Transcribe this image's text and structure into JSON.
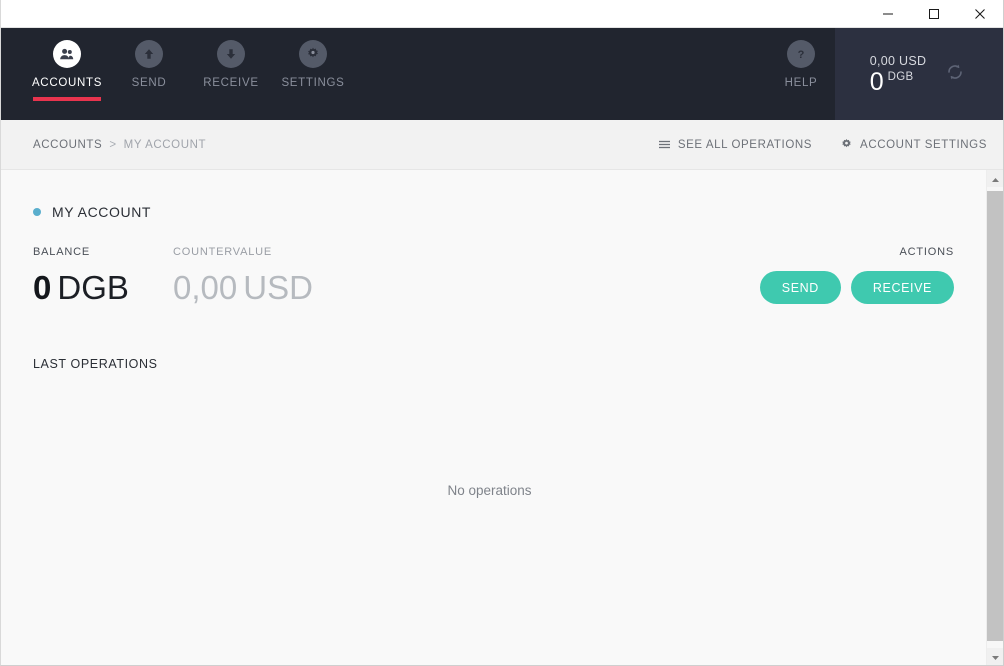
{
  "window": {
    "controls": [
      {
        "name": "minimize",
        "glyph": "minimize-icon",
        "label": "Minimize"
      },
      {
        "name": "maximize",
        "glyph": "maximize-icon",
        "label": "Maximize"
      },
      {
        "name": "close",
        "glyph": "close-icon",
        "label": "Close"
      }
    ]
  },
  "topnav": {
    "items": [
      {
        "label": "ACCOUNTS",
        "icon": "accounts-icon",
        "active": true
      },
      {
        "label": "SEND",
        "icon": "send-arrow-up-icon",
        "active": false
      },
      {
        "label": "RECEIVE",
        "icon": "receive-arrow-down-icon",
        "active": false
      },
      {
        "label": "SETTINGS",
        "icon": "gear-icon",
        "active": false
      }
    ],
    "help": {
      "label": "HELP",
      "icon": "question-mark-icon"
    },
    "active_indicator_color": "#e8344e",
    "background_color": "#21252f"
  },
  "balance_panel": {
    "fiat_value": "0,00 USD",
    "crypto_amount": "0",
    "crypto_unit": "DGB",
    "sync_icon": "refresh-sync-icon",
    "background_color": "#2c3040"
  },
  "breadcrumb": {
    "root": "ACCOUNTS",
    "separator": ">",
    "current": "MY ACCOUNT",
    "actions": [
      {
        "label": "SEE ALL OPERATIONS",
        "icon": "list-lines-icon"
      },
      {
        "label": "ACCOUNT SETTINGS",
        "icon": "gear-icon"
      }
    ]
  },
  "account": {
    "name": "MY ACCOUNT",
    "status_dot_color": "#5aaecd",
    "balance_label": "BALANCE",
    "balance_amount": "0",
    "balance_unit": "DGB",
    "countervalue_label": "COUNTERVALUE",
    "countervalue_amount": "0,00",
    "countervalue_unit": "USD",
    "actions_label": "ACTIONS",
    "send_label": "SEND",
    "receive_label": "RECEIVE",
    "accent_color": "#3fc9af"
  },
  "operations": {
    "heading": "LAST OPERATIONS",
    "empty_message": "No operations"
  },
  "scrollbar": {
    "up_arrow": "chevron-up-icon",
    "down_arrow": "chevron-down-icon"
  }
}
